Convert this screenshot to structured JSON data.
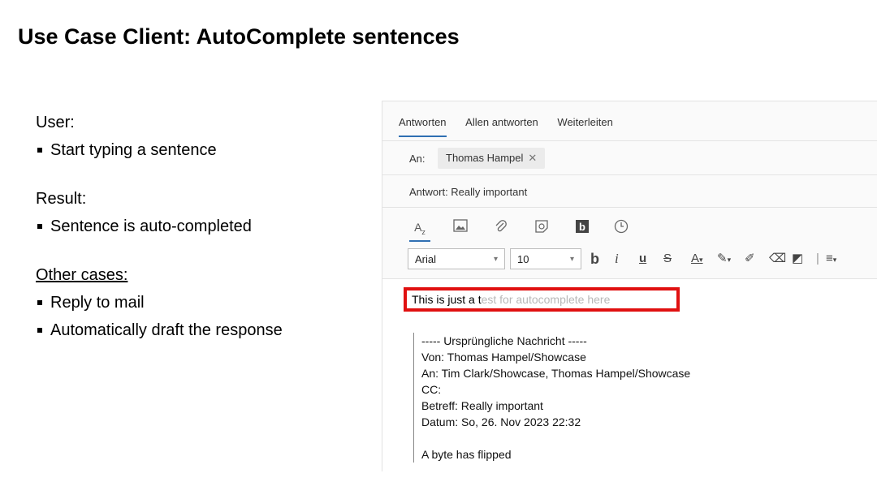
{
  "slide": {
    "title": "Use Case Client: AutoComplete sentences",
    "user_label": "User:",
    "user_items": [
      "Start typing a sentence"
    ],
    "result_label": "Result:",
    "result_items": [
      "Sentence is auto-completed"
    ],
    "other_label": "Other cases:",
    "other_items": [
      "Reply to mail",
      "Automatically draft the response"
    ]
  },
  "mail": {
    "tabs": [
      "Antworten",
      "Allen antworten",
      "Weiterleiten"
    ],
    "active_tab": "Antworten",
    "to_label": "An:",
    "recipient": "Thomas Hampel",
    "subject": "Antwort: Really important",
    "toolbar_icons": [
      "text-format-icon",
      "image-icon",
      "attachment-icon",
      "sticker-icon",
      "bold-b-icon",
      "clock-icon"
    ],
    "font": "Arial",
    "font_size": "10",
    "format_buttons": [
      "b",
      "i",
      "u",
      "s",
      "A",
      "highlight",
      "pen",
      "eraser",
      "clear-format",
      "align"
    ],
    "typed_text": "This is just a t",
    "suggestion_text": "est for autocomplete here",
    "quoted": {
      "header": "----- Ursprüngliche Nachricht -----",
      "from": "Von: Thomas Hampel/Showcase",
      "to": "An: Tim Clark/Showcase, Thomas Hampel/Showcase",
      "cc": "CC:",
      "subject": "Betreff: Really important",
      "date": "Datum: So, 26. Nov 2023 22:32",
      "body": "A byte has flipped"
    }
  },
  "colors": {
    "highlight_border": "#e01010",
    "accent": "#2f6fb2",
    "ghost_text": "#b8b8b8"
  }
}
